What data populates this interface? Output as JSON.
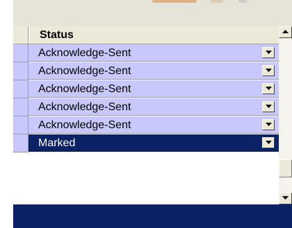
{
  "grid": {
    "header": {
      "status_label": "Status"
    },
    "rows": [
      {
        "status": "Acknowledge-Sent",
        "selected": false
      },
      {
        "status": "Acknowledge-Sent",
        "selected": false
      },
      {
        "status": "Acknowledge-Sent",
        "selected": false
      },
      {
        "status": "Acknowledge-Sent",
        "selected": false
      },
      {
        "status": "Acknowledge-Sent",
        "selected": false
      },
      {
        "status": "Marked",
        "selected": true
      }
    ]
  },
  "icons": {
    "dropdown": "chevron-down-icon",
    "scroll_up": "arrow-up-icon",
    "scroll_down": "arrow-down-icon"
  },
  "colors": {
    "row_background": "#c8c8fc",
    "selected_row": "#0c2266",
    "header_background": "#ece9d8"
  }
}
